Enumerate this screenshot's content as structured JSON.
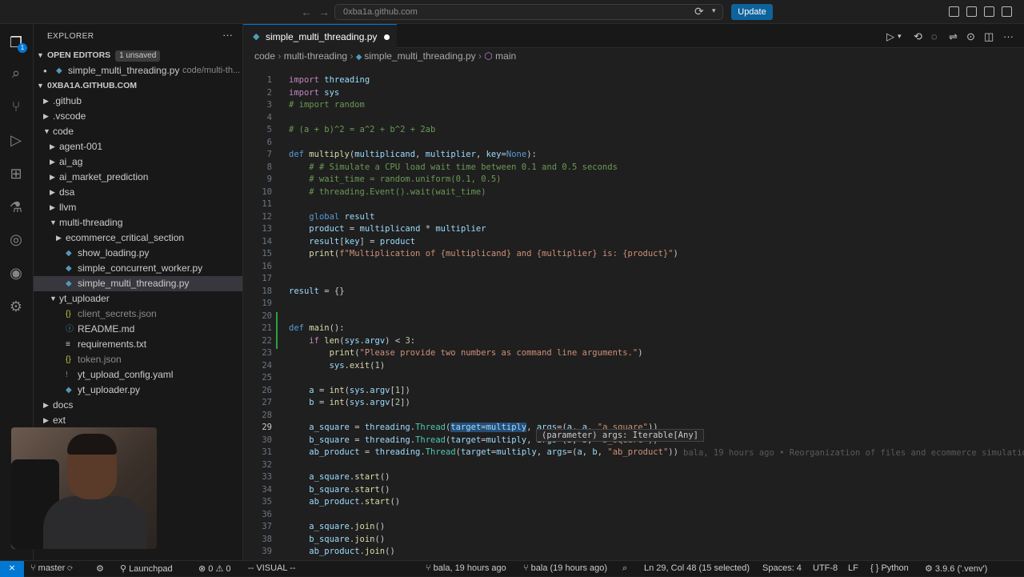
{
  "titlebar": {
    "search": "0xba1a.github.com",
    "update": "Update"
  },
  "explorer": {
    "title": "EXPLORER",
    "open_editors": "OPEN EDITORS",
    "unsaved": "1 unsaved",
    "open_file": "simple_multi_threading.py",
    "open_file_path": "code/multi-th...",
    "workspace": "0XBA1A.GITHUB.COM",
    "tree": [
      {
        "label": ".github",
        "type": "folder",
        "depth": 0,
        "open": false
      },
      {
        "label": ".vscode",
        "type": "folder",
        "depth": 0,
        "open": false
      },
      {
        "label": "code",
        "type": "folder",
        "depth": 0,
        "open": true
      },
      {
        "label": "agent-001",
        "type": "folder",
        "depth": 1,
        "open": false
      },
      {
        "label": "ai_ag",
        "type": "folder",
        "depth": 1,
        "open": false
      },
      {
        "label": "ai_market_prediction",
        "type": "folder",
        "depth": 1,
        "open": false
      },
      {
        "label": "dsa",
        "type": "folder",
        "depth": 1,
        "open": false
      },
      {
        "label": "llvm",
        "type": "folder",
        "depth": 1,
        "open": false
      },
      {
        "label": "multi-threading",
        "type": "folder",
        "depth": 1,
        "open": true
      },
      {
        "label": "ecommerce_critical_section",
        "type": "folder",
        "depth": 2,
        "open": false
      },
      {
        "label": "show_loading.py",
        "type": "py",
        "depth": 2
      },
      {
        "label": "simple_concurrent_worker.py",
        "type": "py",
        "depth": 2
      },
      {
        "label": "simple_multi_threading.py",
        "type": "py",
        "depth": 2,
        "selected": true
      },
      {
        "label": "yt_uploader",
        "type": "folder",
        "depth": 1,
        "open": true
      },
      {
        "label": "client_secrets.json",
        "type": "json",
        "depth": 2,
        "dim": true
      },
      {
        "label": "README.md",
        "type": "md",
        "depth": 2
      },
      {
        "label": "requirements.txt",
        "type": "txt",
        "depth": 2
      },
      {
        "label": "token.json",
        "type": "json",
        "depth": 2,
        "dim": true
      },
      {
        "label": "yt_upload_config.yaml",
        "type": "yaml",
        "depth": 2
      },
      {
        "label": "yt_uploader.py",
        "type": "py",
        "depth": 2
      },
      {
        "label": "docs",
        "type": "folder",
        "depth": 0,
        "open": false
      },
      {
        "label": "ext",
        "type": "folder",
        "depth": 0,
        "open": false
      }
    ]
  },
  "tab": {
    "label": "simple_multi_threading.py"
  },
  "breadcrumb": {
    "a": "code",
    "b": "multi-threading",
    "c": "simple_multi_threading.py",
    "d": "main"
  },
  "hover": "(parameter) args: Iterable[Any]",
  "blame": "bala, 19 hours ago • Reorganization of files and ecommerce simulatio",
  "code_lines": [
    "import threading",
    "import sys",
    "# import random",
    "",
    "# (a + b)^2 = a^2 + b^2 + 2ab",
    "",
    "def multiply(multiplicand, multiplier, key=None):",
    "    # # Simulate a CPU load wait time between 0.1 and 0.5 seconds",
    "    # wait_time = random.uniform(0.1, 0.5)",
    "    # threading.Event().wait(wait_time)",
    "",
    "    global result",
    "    product = multiplicand * multiplier",
    "    result[key] = product",
    "    print(f\"Multiplication of {multiplicand} and {multiplier} is: {product}\")",
    "",
    "",
    "result = {}",
    "",
    "",
    "def main():",
    "    if len(sys.argv) < 3:",
    "        print(\"Please provide two numbers as command line arguments.\")",
    "        sys.exit(1)",
    "",
    "    a = int(sys.argv[1])",
    "    b = int(sys.argv[2])",
    "",
    "    a_square = threading.Thread(target=multiply, args=(a, a, \"a_square\"))",
    "    b_square = threading.Thread(target=multiply, args=(b, b, \"b_square\"))",
    "    ab_product = threading.Thread(target=multiply, args=(a, b, \"ab_product\"))",
    "",
    "    a_square.start()",
    "    b_square.start()",
    "    ab_product.start()",
    "",
    "    a_square.join()",
    "    b_square.join()",
    "    ab_product.join()"
  ],
  "status": {
    "branch": "master",
    "launchpad": "Launchpad",
    "errors": "0",
    "warnings": "0",
    "mode": "-- VISUAL --",
    "blame": "bala, 19 hours ago",
    "author": "bala (19 hours ago)",
    "position": "Ln 29, Col 48 (15 selected)",
    "spaces": "Spaces: 4",
    "encoding": "UTF-8",
    "eol": "LF",
    "language": "Python",
    "interpreter": "3.9.6 ('.venv')"
  }
}
